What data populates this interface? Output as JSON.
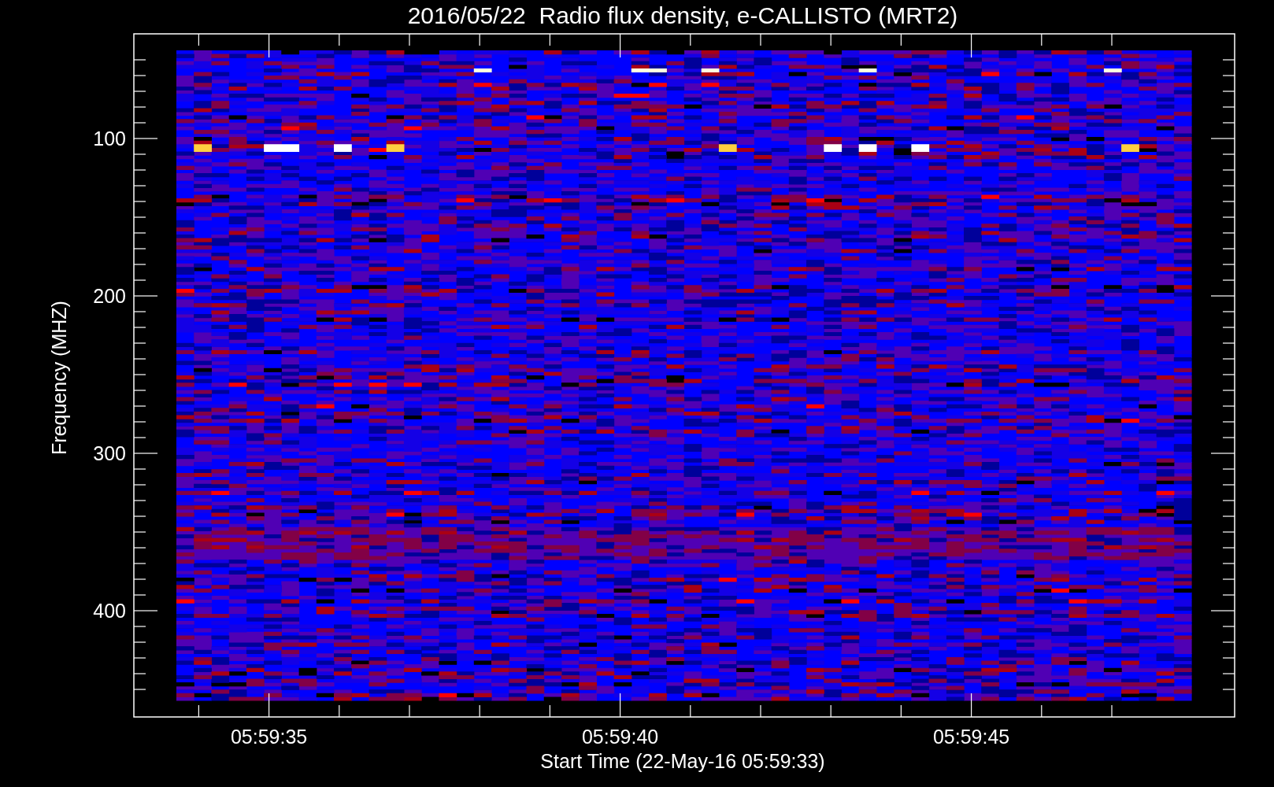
{
  "title": "2016/05/22  Radio flux density, e-CALLISTO (MRT2)",
  "y_axis": {
    "label": "Frequency (MHZ)",
    "ticks": [
      "100",
      "200",
      "300",
      "400"
    ]
  },
  "x_axis": {
    "label": "Start Time (22-May-16 05:59:33)",
    "ticks": [
      "05:59:35",
      "05:59:40",
      "05:59:45"
    ]
  }
}
